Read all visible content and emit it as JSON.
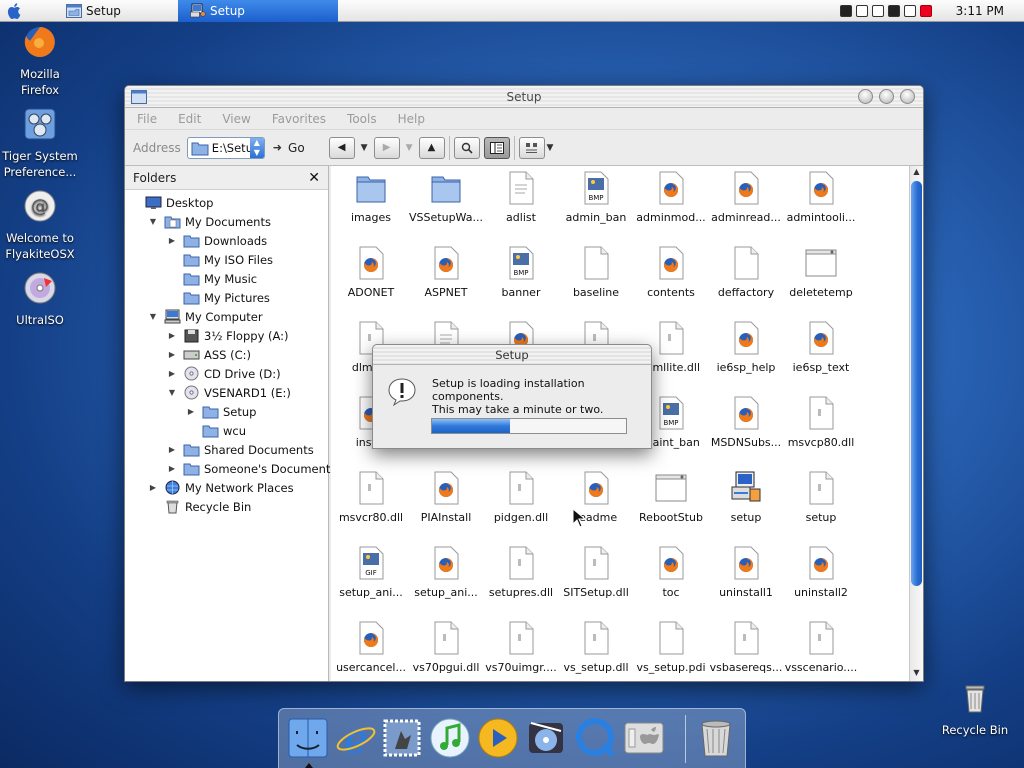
{
  "menubar": {
    "tasks": [
      {
        "label": "Setup",
        "active": false
      },
      {
        "label": "Setup",
        "active": true
      }
    ],
    "clock": "3:11 PM"
  },
  "desktop_icons": [
    {
      "label": "Mozilla Firefox"
    },
    {
      "label": "Tiger System Preference..."
    },
    {
      "label": "Welcome to FlyakiteOSX"
    },
    {
      "label": "UltraISO"
    },
    {
      "label": "Recycle Bin"
    }
  ],
  "window": {
    "title": "Setup",
    "menu": [
      "File",
      "Edit",
      "View",
      "Favorites",
      "Tools",
      "Help"
    ],
    "address_label": "Address",
    "address_value": "E:\\Setup",
    "go_label": "Go"
  },
  "folders": {
    "header": "Folders",
    "close": "✕",
    "items": [
      {
        "label": "Desktop",
        "icon": "desktop-icon"
      },
      {
        "label": "My Documents",
        "icon": "my-documents-icon"
      },
      {
        "label": "Downloads",
        "icon": "folder-icon"
      },
      {
        "label": "My ISO Files",
        "icon": "folder-icon"
      },
      {
        "label": "My Music",
        "icon": "folder-icon"
      },
      {
        "label": "My Pictures",
        "icon": "folder-icon"
      },
      {
        "label": "My Computer",
        "icon": "computer-icon"
      },
      {
        "label": "3½ Floppy (A:)",
        "icon": "floppy-icon"
      },
      {
        "label": "ASS (C:)",
        "icon": "hard-drive-icon"
      },
      {
        "label": "CD Drive (D:)",
        "icon": "cd-drive-icon"
      },
      {
        "label": "VSENARD1 (E:)",
        "icon": "cd-drive-icon"
      },
      {
        "label": "Setup",
        "icon": "folder-icon"
      },
      {
        "label": "wcu",
        "icon": "folder-icon"
      },
      {
        "label": "Shared Documents",
        "icon": "folder-icon"
      },
      {
        "label": "Someone's Documents",
        "icon": "folder-icon"
      },
      {
        "label": "My Network Places",
        "icon": "network-icon"
      },
      {
        "label": "Recycle Bin",
        "icon": "recycle-bin-icon"
      }
    ]
  },
  "files": [
    {
      "name": "images",
      "type": "folder"
    },
    {
      "name": "VSSetupWa...",
      "type": "folder"
    },
    {
      "name": "adlist",
      "type": "text"
    },
    {
      "name": "admin_ban",
      "type": "bmp"
    },
    {
      "name": "adminmod...",
      "type": "firefox"
    },
    {
      "name": "adminread...",
      "type": "firefox"
    },
    {
      "name": "admintooli...",
      "type": "firefox"
    },
    {
      "name": "ADONET",
      "type": "firefox"
    },
    {
      "name": "ASPNET",
      "type": "firefox"
    },
    {
      "name": "banner",
      "type": "bmp"
    },
    {
      "name": "baseline",
      "type": "blank"
    },
    {
      "name": "contents",
      "type": "firefox"
    },
    {
      "name": "deffactory",
      "type": "blank"
    },
    {
      "name": "deletetemp",
      "type": "app"
    },
    {
      "name": "dlmg...",
      "type": "dll"
    },
    {
      "name": "",
      "type": "text"
    },
    {
      "name": "",
      "type": "firefox"
    },
    {
      "name": "",
      "type": "dll"
    },
    {
      "name": "...mllite.dll",
      "type": "dll"
    },
    {
      "name": "ie6sp_help",
      "type": "firefox"
    },
    {
      "name": "ie6sp_text",
      "type": "firefox"
    },
    {
      "name": "inst...",
      "type": "firefox"
    },
    {
      "name": "",
      "type": "blank"
    },
    {
      "name": "",
      "type": "blank"
    },
    {
      "name": "",
      "type": "blank"
    },
    {
      "name": "...aint_ban",
      "type": "bmp"
    },
    {
      "name": "MSDNSubs...",
      "type": "firefox"
    },
    {
      "name": "msvcp80.dll",
      "type": "dll"
    },
    {
      "name": "msvcr80.dll",
      "type": "dll"
    },
    {
      "name": "PIAInstall",
      "type": "firefox"
    },
    {
      "name": "pidgen.dll",
      "type": "dll"
    },
    {
      "name": "readme",
      "type": "firefox"
    },
    {
      "name": "RebootStub",
      "type": "app"
    },
    {
      "name": "setup",
      "type": "setup"
    },
    {
      "name": "setup",
      "type": "dll"
    },
    {
      "name": "setup_ani...",
      "type": "gif"
    },
    {
      "name": "setup_ani...",
      "type": "firefox"
    },
    {
      "name": "setupres.dll",
      "type": "dll"
    },
    {
      "name": "SITSetup.dll",
      "type": "dll"
    },
    {
      "name": "toc",
      "type": "firefox"
    },
    {
      "name": "uninstall1",
      "type": "firefox"
    },
    {
      "name": "uninstall2",
      "type": "firefox"
    },
    {
      "name": "usercancel...",
      "type": "firefox"
    },
    {
      "name": "vs70pgui.dll",
      "type": "dll"
    },
    {
      "name": "vs70uimgr....",
      "type": "dll"
    },
    {
      "name": "vs_setup.dll",
      "type": "dll"
    },
    {
      "name": "vs_setup.pdi",
      "type": "blank"
    },
    {
      "name": "vsbasereqs...",
      "type": "dll"
    },
    {
      "name": "vsscenario....",
      "type": "dll"
    }
  ],
  "dialog": {
    "title": "Setup",
    "line1": "Setup is loading installation components.",
    "line2": "This may take a minute or two.",
    "progress": 0.4
  },
  "dock": [
    "Finder",
    "Internet Explorer",
    "Mail",
    "iTunes",
    "QuickTime Player",
    "DVD Player",
    "QuickTime",
    "System Preferences",
    "Trash"
  ]
}
